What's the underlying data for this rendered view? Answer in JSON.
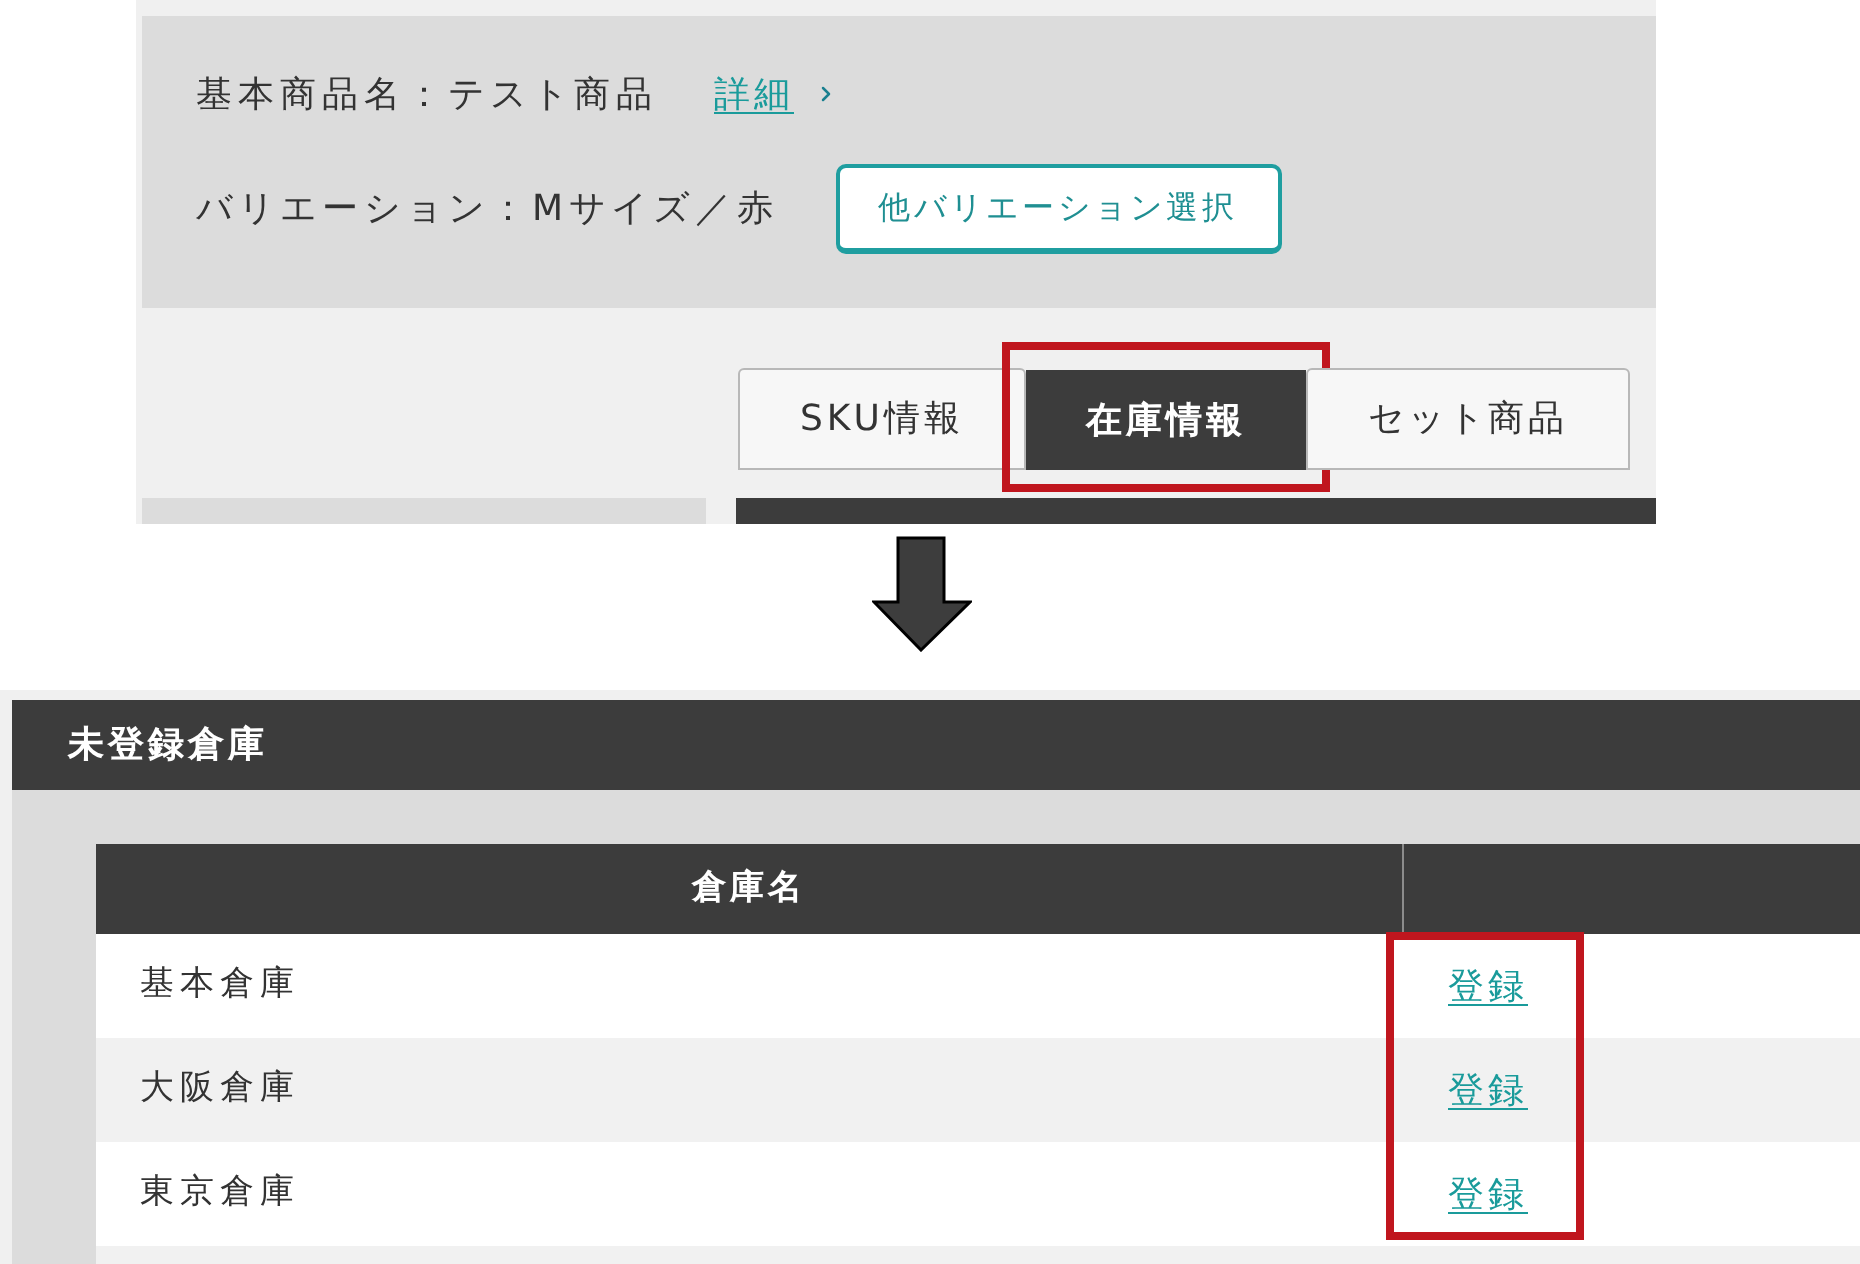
{
  "product_panel": {
    "base_name_label": "基本商品名：テスト商品",
    "detail_link": "詳細",
    "variation_label": "バリエーション：Mサイズ／赤",
    "other_variation_button": "他バリエーション選択"
  },
  "tabs": [
    {
      "label": "SKU情報",
      "selected": false,
      "highlighted": false
    },
    {
      "label": "在庫情報",
      "selected": true,
      "highlighted": true
    },
    {
      "label": "セット商品",
      "selected": false,
      "highlighted": false
    }
  ],
  "unregistered_warehouses": {
    "title": "未登録倉庫",
    "columns": [
      "倉庫名"
    ],
    "action_column_highlighted": true,
    "rows": [
      {
        "name": "基本倉庫",
        "action": "登録"
      },
      {
        "name": "大阪倉庫",
        "action": "登録"
      },
      {
        "name": "東京倉庫",
        "action": "登録"
      }
    ]
  }
}
